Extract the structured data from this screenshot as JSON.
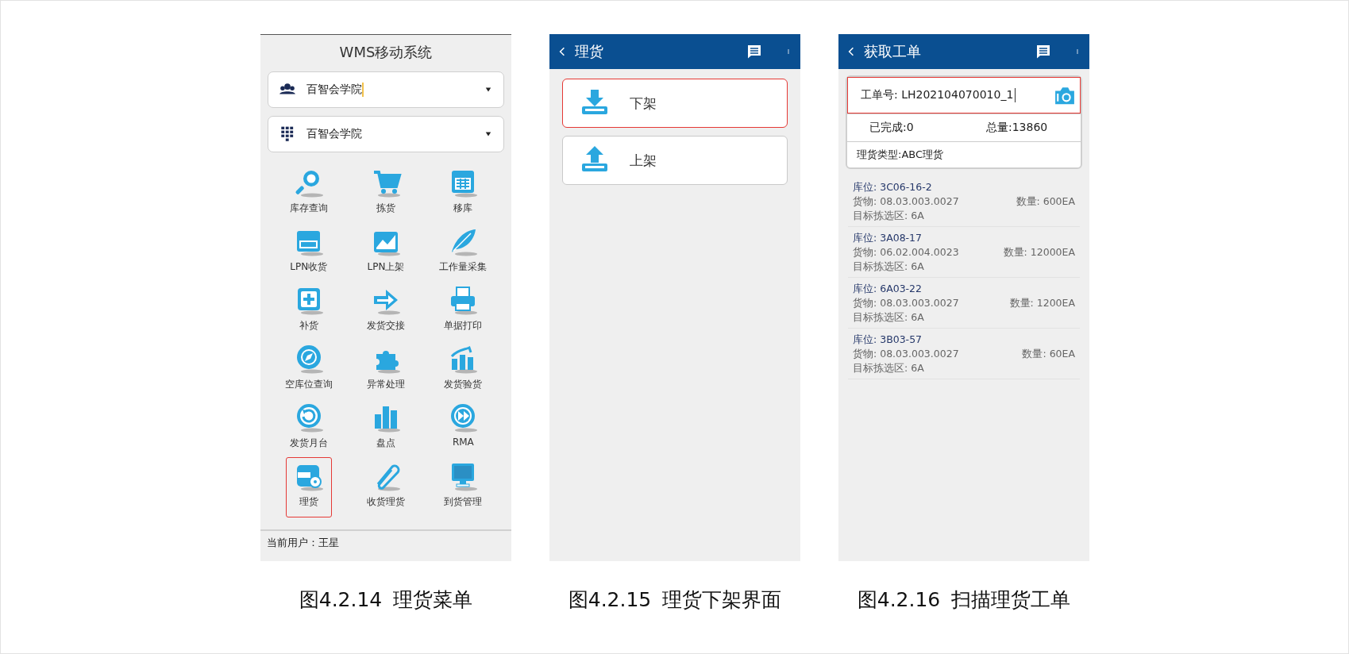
{
  "figures": [
    {
      "kind": "menu",
      "caption_number": "图4.2.14",
      "caption_title": "理货菜单",
      "screen": {
        "title": "WMS移动系统",
        "dropdowns": [
          {
            "value": "百智会学院",
            "focused": true
          },
          {
            "value": "百智会学院",
            "focused": false
          }
        ],
        "menu_items": [
          {
            "label": "库存查询",
            "highlighted": false
          },
          {
            "label": "拣货",
            "highlighted": false
          },
          {
            "label": "移库",
            "highlighted": false
          },
          {
            "label": "LPN收货",
            "highlighted": false
          },
          {
            "label": "LPN上架",
            "highlighted": false
          },
          {
            "label": "工作量采集",
            "highlighted": false
          },
          {
            "label": "补货",
            "highlighted": false
          },
          {
            "label": "发货交接",
            "highlighted": false
          },
          {
            "label": "单据打印",
            "highlighted": false
          },
          {
            "label": "空库位查询",
            "highlighted": false
          },
          {
            "label": "异常处理",
            "highlighted": false
          },
          {
            "label": "发货验货",
            "highlighted": false
          },
          {
            "label": "发货月台",
            "highlighted": false
          },
          {
            "label": "盘点",
            "highlighted": false
          },
          {
            "label": "RMA",
            "highlighted": false
          },
          {
            "label": "理货",
            "highlighted": true
          },
          {
            "label": "收货理货",
            "highlighted": false
          },
          {
            "label": "到货管理",
            "highlighted": false
          }
        ],
        "footer": "当前用户：王星"
      }
    },
    {
      "kind": "options",
      "caption_number": "图4.2.15",
      "caption_title": "理货下架界面",
      "screen": {
        "title": "理货",
        "options": [
          {
            "label": "下架",
            "highlighted": true
          },
          {
            "label": "上架",
            "highlighted": false
          }
        ]
      }
    },
    {
      "kind": "order",
      "caption_number": "图4.2.16",
      "caption_title": "扫描理货工单",
      "screen": {
        "title": "获取工单",
        "order_field": {
          "value": "工单号: LH202104070010_1",
          "focused": true,
          "highlighted": true
        },
        "completed": "已完成:0",
        "total": "总量:13860",
        "type": "理货类型:ABC理货",
        "items": [
          {
            "location": "库位: 3C06-16-2",
            "goods": "货物: 08.03.003.0027",
            "quantity": "数量: 600EA",
            "zone": "目标拣选区: 6A"
          },
          {
            "location": "库位: 3A08-17",
            "goods": "货物: 06.02.004.0023",
            "quantity": "数量: 12000EA",
            "zone": "目标拣选区: 6A"
          },
          {
            "location": "库位: 6A03-22",
            "goods": "货物: 08.03.003.0027",
            "quantity": "数量: 1200EA",
            "zone": "目标拣选区: 6A"
          },
          {
            "location": "库位: 3B03-57",
            "goods": "货物: 08.03.003.0027",
            "quantity": "数量: 60EA",
            "zone": "目标拣选区: 6A"
          }
        ]
      }
    }
  ]
}
